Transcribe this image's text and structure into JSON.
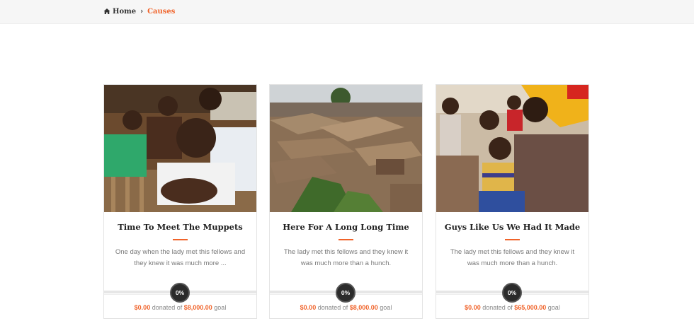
{
  "breadcrumb": {
    "home_label": "Home",
    "current_label": "Causes",
    "home_icon": "home-icon",
    "separator_icon": "chevron-right-icon"
  },
  "colors": {
    "accent": "#f0632a",
    "badge": "#2b2b2b",
    "track": "#e6e6e6"
  },
  "causes": [
    {
      "title": "Time To Meet The Muppets",
      "description": "One day when the lady met this fellows and they knew it was much more ...",
      "progress": 0,
      "progress_label": "0%",
      "raised": "$0.00",
      "donated_text": " donated of ",
      "goal": "$8,000.00",
      "goal_text": " goal"
    },
    {
      "title": "Here For A Long Long Time",
      "description": "The lady met this fellows and they knew it was much more than a hunch.",
      "progress": 0,
      "progress_label": "0%",
      "raised": "$0.00",
      "donated_text": " donated of ",
      "goal": "$8,000.00",
      "goal_text": " goal"
    },
    {
      "title": "Guys Like Us We Had It Made",
      "description": "The lady met this fellows and they knew it was much more than a hunch.",
      "progress": 0,
      "progress_label": "0%",
      "raised": "$0.00",
      "donated_text": " donated of ",
      "goal": "$65,000.00",
      "goal_text": " goal"
    }
  ]
}
